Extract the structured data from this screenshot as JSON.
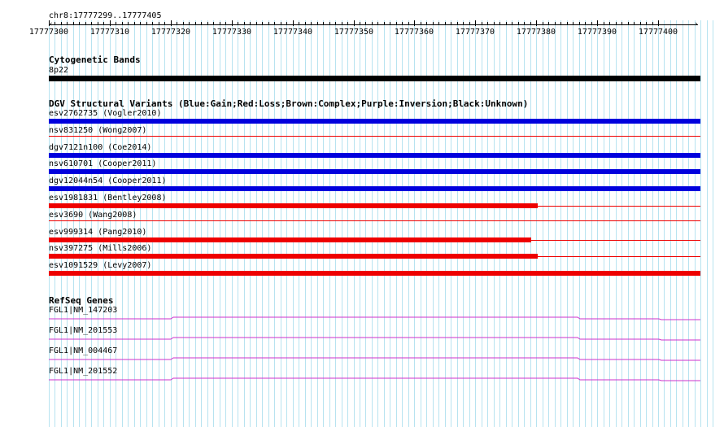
{
  "ruler": {
    "location": "chr8:17777299..17777405",
    "ticks": [
      "17777300",
      "17777310",
      "17777320",
      "17777330",
      "17777340",
      "17777350",
      "17777360",
      "17777370",
      "17777380",
      "17777390",
      "17777400"
    ]
  },
  "cytoband": {
    "title": "Cytogenetic Bands",
    "band": "8p22",
    "color": "#000000"
  },
  "dgv": {
    "title": "DGV Structural Variants (Blue:Gain;Red:Loss;Brown:Complex;Purple:Inversion;Black:Unknown)",
    "colors": {
      "gain": "#0000dd",
      "loss": "#ee0000"
    },
    "variants": [
      {
        "label": "esv2762735 (Vogler2010)",
        "type": "gain",
        "coverage": 1.0
      },
      {
        "label": "nsv831250 (Wong2007)",
        "type": "loss",
        "coverage": 1.0
      },
      {
        "label": "dgv7121n100 (Coe2014)",
        "type": "gain",
        "coverage": 1.0
      },
      {
        "label": "nsv610701 (Cooper2011)",
        "type": "gain",
        "coverage": 1.0
      },
      {
        "label": "dgv12044n54 (Cooper2011)",
        "type": "gain",
        "coverage": 1.0
      },
      {
        "label": "esv1981831 (Bentley2008)",
        "type": "loss",
        "coverage": 0.75
      },
      {
        "label": "esv3690 (Wang2008)",
        "type": "loss",
        "coverage": 1.0
      },
      {
        "label": "esv999314 (Pang2010)",
        "type": "loss",
        "coverage": 0.74
      },
      {
        "label": "nsv397275 (Mills2006)",
        "type": "loss",
        "coverage": 0.75
      },
      {
        "label": "esv1091529 (Levy2007)",
        "type": "loss",
        "coverage": 1.0
      }
    ]
  },
  "refseq": {
    "title": "RefSeq Genes",
    "color": "#cc33cc",
    "genes": [
      {
        "label": "FGL1|NM_147203"
      },
      {
        "label": "FGL1|NM_201553"
      },
      {
        "label": "FGL1|NM_004467"
      },
      {
        "label": "FGL1|NM_201552"
      }
    ]
  }
}
